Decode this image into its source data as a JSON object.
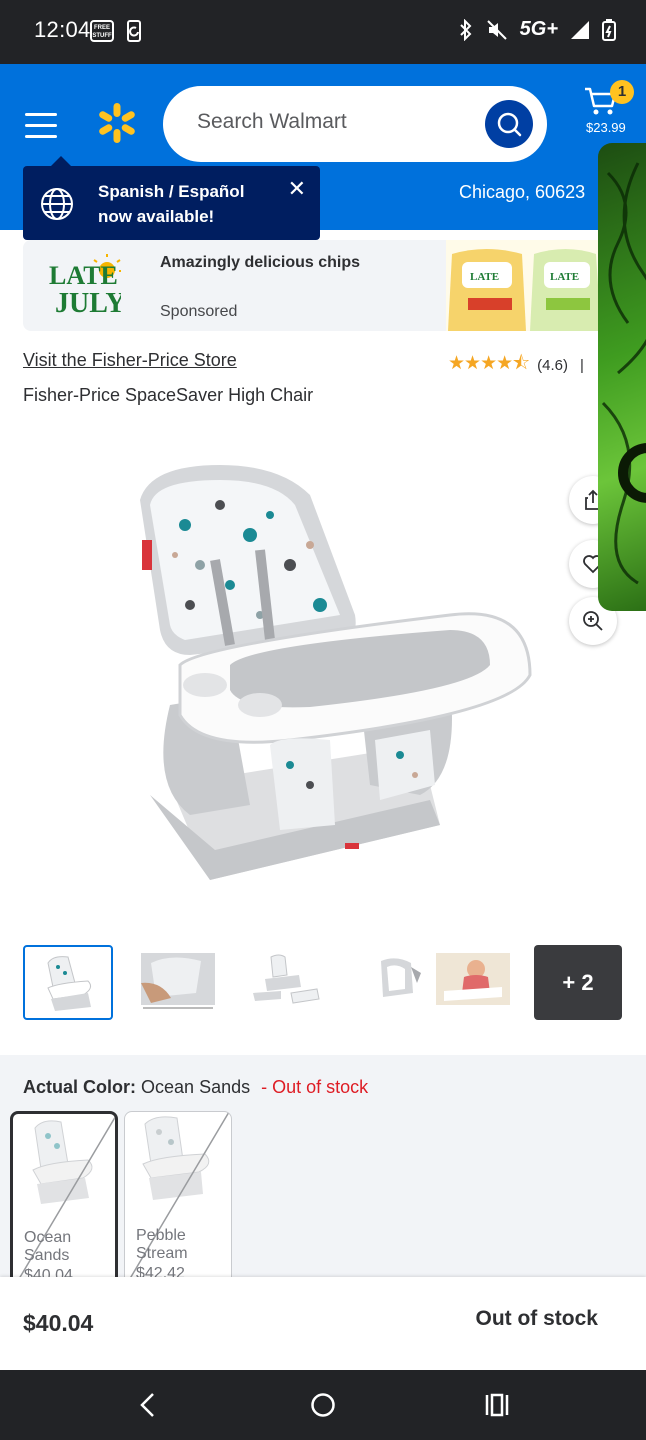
{
  "status_bar": {
    "time": "12:04",
    "badge_text": "FREE STUFF",
    "network": "5G+"
  },
  "header": {
    "search_placeholder": "Search Walmart",
    "cart_count": "1",
    "cart_total": "$23.99",
    "location": "Chicago, 60623"
  },
  "tooltip": {
    "message": "Spanish / Español now available!",
    "close": "✕"
  },
  "ad": {
    "title": "Amazingly delicious chips",
    "sponsored": "Sponsored",
    "logo_text": "LATE JULY"
  },
  "product": {
    "store_link": "Visit the Fisher-Price Store",
    "rating_text": "(4.6)",
    "rating_value": 4.6,
    "separator": "|",
    "title": "Fisher-Price SpaceSaver High Chair"
  },
  "thumbnails": {
    "more_label": "+ 2"
  },
  "color": {
    "label": "Actual Color:",
    "value": "Ocean Sands",
    "stock_note": "- Out of stock",
    "swatches": [
      {
        "name": "Ocean Sands",
        "price": "$40.04"
      },
      {
        "name": "Pebble Stream",
        "price": "$42.42"
      }
    ]
  },
  "bottom_bar": {
    "price": "$40.04",
    "stock": "Out of stock"
  },
  "colors": {
    "brand_blue": "#0071dc",
    "dark_blue": "#001e60",
    "spark_yellow": "#ffc220",
    "out_of_stock_red": "#de1c24"
  }
}
